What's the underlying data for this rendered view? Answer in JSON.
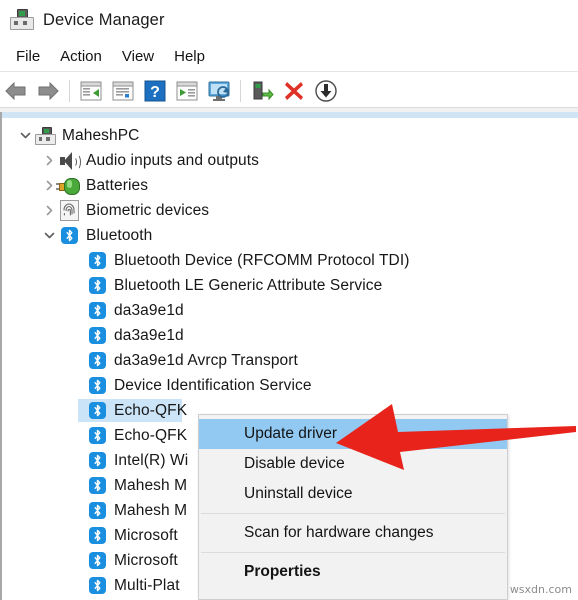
{
  "window": {
    "title": "Device Manager",
    "icon": "computer-icon"
  },
  "menubar": {
    "items": [
      {
        "label": "File"
      },
      {
        "label": "Action"
      },
      {
        "label": "View"
      },
      {
        "label": "Help"
      }
    ]
  },
  "toolbar": {
    "buttons": [
      {
        "name": "back-button",
        "icon": "back-arrow-icon"
      },
      {
        "name": "forward-button",
        "icon": "forward-arrow-icon"
      },
      {
        "name": "separator-1",
        "icon": "separator"
      },
      {
        "name": "show-hide-console-tree-button",
        "icon": "console-tree-icon"
      },
      {
        "name": "properties-button",
        "icon": "properties-window-icon"
      },
      {
        "name": "help-button",
        "icon": "question-mark-icon"
      },
      {
        "name": "scan-for-hardware-changes-button",
        "icon": "scan-hardware-icon"
      },
      {
        "name": "update-driver-button",
        "icon": "monitor-update-icon"
      },
      {
        "name": "separator-2",
        "icon": "separator"
      },
      {
        "name": "enable-device-button",
        "icon": "enable-device-icon"
      },
      {
        "name": "uninstall-device-button",
        "icon": "red-x-icon"
      },
      {
        "name": "install-legacy-hardware-button",
        "icon": "down-arrow-circle-icon"
      }
    ]
  },
  "tree": {
    "rows": [
      {
        "label": "MaheshPC",
        "icon": "computer-icon",
        "indent": 0,
        "twisty": "expanded",
        "selected": false
      },
      {
        "label": "Audio inputs and outputs",
        "icon": "speaker-icon",
        "indent": 1,
        "twisty": "collapsed",
        "selected": false
      },
      {
        "label": "Batteries",
        "icon": "battery-icon",
        "indent": 1,
        "twisty": "collapsed",
        "selected": false
      },
      {
        "label": "Biometric devices",
        "icon": "fingerprint-icon",
        "indent": 1,
        "twisty": "collapsed",
        "selected": false
      },
      {
        "label": "Bluetooth",
        "icon": "bluetooth-icon",
        "indent": 1,
        "twisty": "expanded",
        "selected": false
      },
      {
        "label": "Bluetooth Device (RFCOMM Protocol TDI)",
        "icon": "bluetooth-icon",
        "indent": 2,
        "twisty": "none",
        "selected": false
      },
      {
        "label": "Bluetooth LE Generic Attribute Service",
        "icon": "bluetooth-icon",
        "indent": 2,
        "twisty": "none",
        "selected": false
      },
      {
        "label": "da3a9e1d",
        "icon": "bluetooth-icon",
        "indent": 2,
        "twisty": "none",
        "selected": false
      },
      {
        "label": "da3a9e1d",
        "icon": "bluetooth-icon",
        "indent": 2,
        "twisty": "none",
        "selected": false
      },
      {
        "label": "da3a9e1d Avrcp Transport",
        "icon": "bluetooth-icon",
        "indent": 2,
        "twisty": "none",
        "selected": false
      },
      {
        "label": "Device Identification Service",
        "icon": "bluetooth-icon",
        "indent": 2,
        "twisty": "none",
        "selected": false
      },
      {
        "label": "Echo-QFK",
        "icon": "bluetooth-icon",
        "indent": 2,
        "twisty": "none",
        "selected": true
      },
      {
        "label": "Echo-QFK",
        "icon": "bluetooth-icon",
        "indent": 2,
        "twisty": "none",
        "selected": false
      },
      {
        "label": "Intel(R) Wi",
        "icon": "bluetooth-icon",
        "indent": 2,
        "twisty": "none",
        "selected": false
      },
      {
        "label": "Mahesh M",
        "icon": "bluetooth-icon",
        "indent": 2,
        "twisty": "none",
        "selected": false
      },
      {
        "label": "Mahesh M",
        "icon": "bluetooth-icon",
        "indent": 2,
        "twisty": "none",
        "selected": false
      },
      {
        "label": "Microsoft",
        "icon": "bluetooth-icon",
        "indent": 2,
        "twisty": "none",
        "selected": false
      },
      {
        "label": "Microsoft",
        "icon": "bluetooth-icon",
        "indent": 2,
        "twisty": "none",
        "selected": false
      },
      {
        "label": "Multi-Plat",
        "icon": "bluetooth-icon",
        "indent": 2,
        "twisty": "none",
        "selected": false
      }
    ]
  },
  "context_menu": {
    "items": [
      {
        "label": "Update driver",
        "highlighted": true,
        "bold": false
      },
      {
        "label": "Disable device",
        "highlighted": false,
        "bold": false
      },
      {
        "label": "Uninstall device",
        "highlighted": false,
        "bold": false
      },
      {
        "label": "Scan for hardware changes",
        "highlighted": false,
        "bold": false
      },
      {
        "label": "Properties",
        "highlighted": false,
        "bold": true
      }
    ]
  },
  "annotation": {
    "arrow": "red-left-arrow",
    "color": "#e8231b"
  },
  "watermark": {
    "text": "wsxdn.com"
  },
  "colors": {
    "selection_blue": "#cce4f7",
    "menu_highlight_blue": "#91c9f2",
    "bluetooth_blue": "#1a8fe0",
    "annotation_red": "#e8231b",
    "window_bg": "#ffffff",
    "menu_bg": "#f2f2f2"
  }
}
